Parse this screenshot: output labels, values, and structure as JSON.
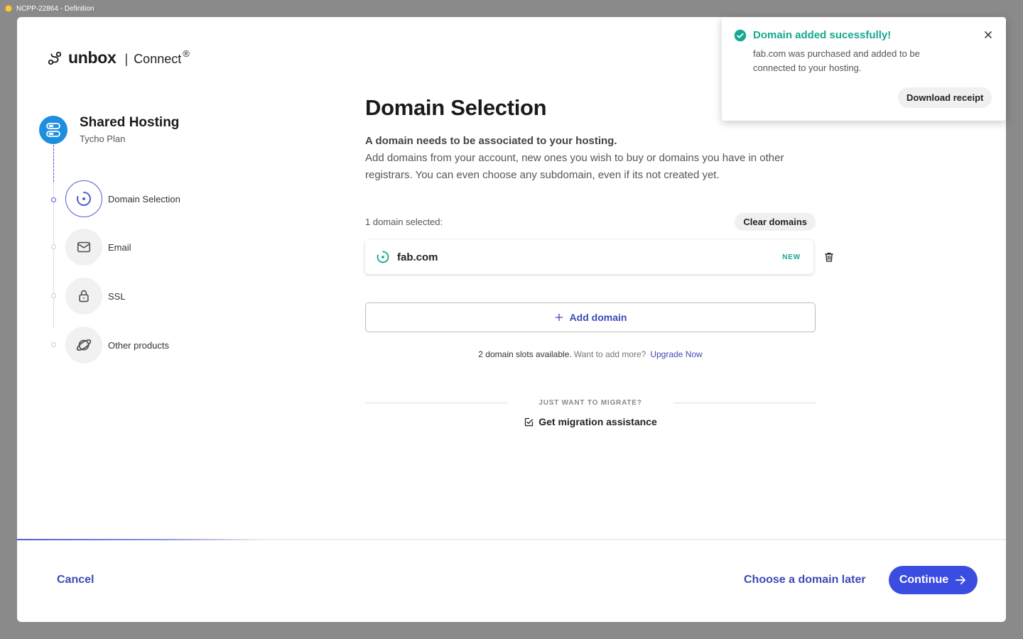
{
  "window": {
    "title": "NCPP-22864 - Definition"
  },
  "header": {
    "brand": "unbox",
    "separator": "|",
    "product": "Connect",
    "reg": "®"
  },
  "stepper": {
    "plan_title": "Shared Hosting",
    "plan_subtitle": "Tycho Plan",
    "steps": [
      {
        "label": "Domain Selection",
        "icon": "target-icon",
        "active": true
      },
      {
        "label": "Email",
        "icon": "mail-icon",
        "active": false
      },
      {
        "label": "SSL",
        "icon": "lock-icon",
        "active": false
      },
      {
        "label": "Other products",
        "icon": "planet-icon",
        "active": false
      }
    ]
  },
  "main": {
    "title": "Domain Selection",
    "lead": "A domain needs to be associated to your hosting.",
    "description": "Add domains from your account, new ones you wish to buy or domains you have in other registrars. You can even choose any subdomain, even if its not created yet.",
    "selected_count": "1 domain selected:",
    "clear_label": "Clear domains",
    "domains": [
      {
        "name": "fab.com",
        "badge": "NEW"
      }
    ],
    "add_domain_label": "Add domain",
    "slots_text": "2 domain slots available.",
    "slots_prompt": "Want to add more?",
    "upgrade_label": "Upgrade Now",
    "migrate_heading": "JUST WANT TO MIGRATE?",
    "migrate_label": "Get migration assistance"
  },
  "footer": {
    "cancel_label": "Cancel",
    "later_label": "Choose a domain later",
    "continue_label": "Continue",
    "progress_fraction": 0.25
  },
  "toast": {
    "title": "Domain added sucessfully!",
    "message": "fab.com was purchased and added to be connected to your hosting.",
    "action_label": "Download receipt"
  },
  "colors": {
    "accent": "#3b4ce0",
    "link": "#3d4ab8",
    "success": "#17a88f",
    "plan_icon": "#1d8fe0"
  }
}
